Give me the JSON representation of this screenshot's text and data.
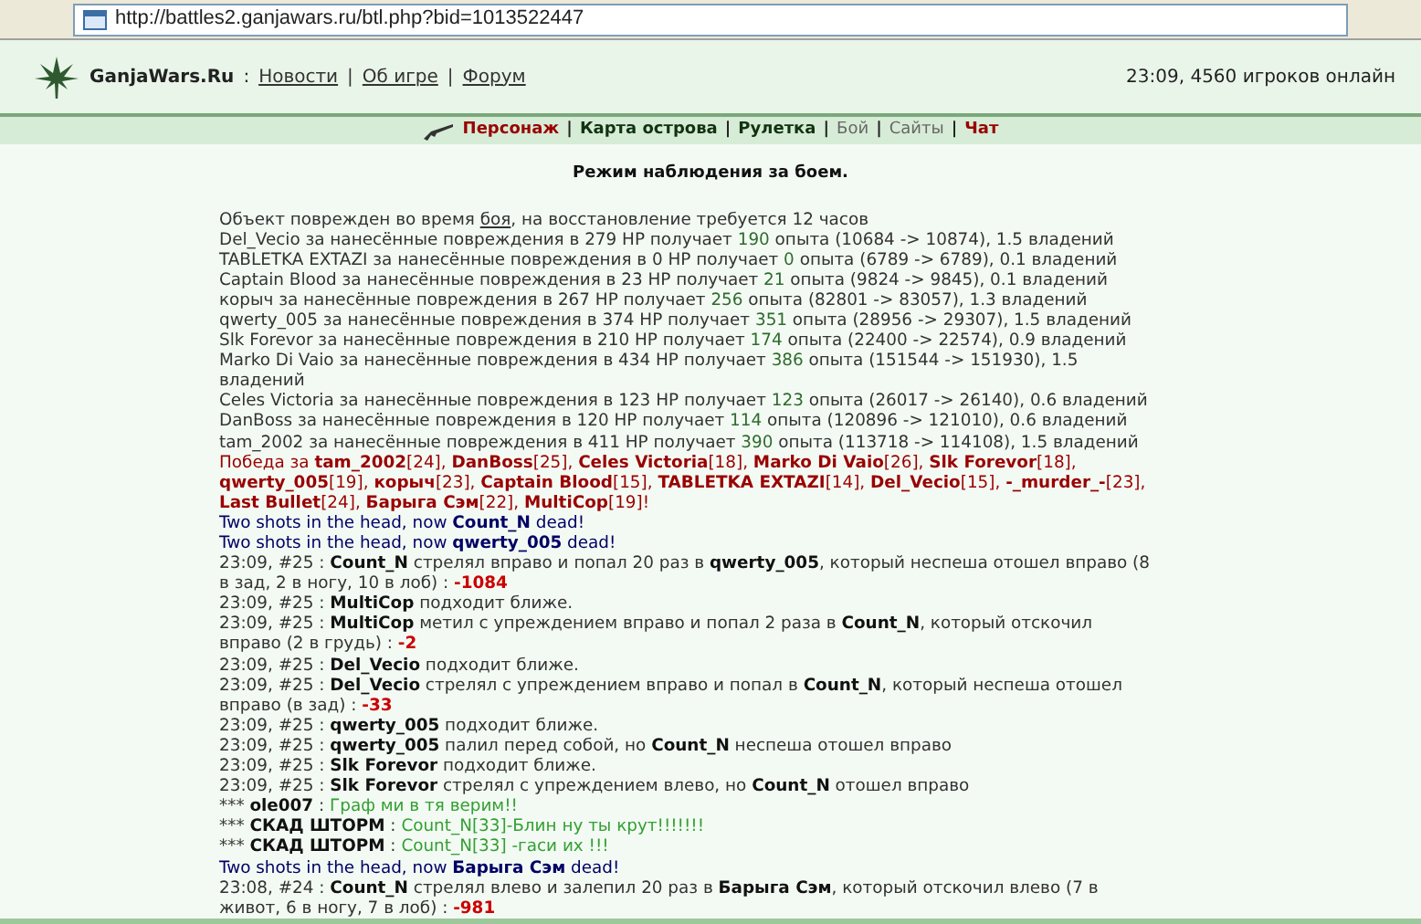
{
  "browser": {
    "address": "http://battles2.ganjawars.ru/btl.php?bid=1013522447"
  },
  "header": {
    "site": "GanjaWars.Ru",
    "colon": ":",
    "links": [
      "Новости",
      "Об игре",
      "Форум"
    ],
    "separator": "|",
    "online": "23:09, 4560 игроков онлайн"
  },
  "nav": {
    "separator": "|",
    "items": [
      {
        "label": "Персонаж",
        "kind": "accent",
        "icon": true
      },
      {
        "label": "Карта острова",
        "kind": "bold",
        "icon": false
      },
      {
        "label": "Рулетка",
        "kind": "bold",
        "icon": false
      },
      {
        "label": "Бой",
        "kind": "plain",
        "icon": false
      },
      {
        "label": "Сайты",
        "kind": "plain",
        "icon": false
      },
      {
        "label": "Чат",
        "kind": "accent",
        "icon": false
      }
    ]
  },
  "title": "Режим наблюдения за боем.",
  "log": [
    {
      "kind": "info",
      "parts": [
        {
          "kind": "t",
          "text": "Объект поврежден во время "
        },
        {
          "kind": "u",
          "text": "боя"
        },
        {
          "kind": "t",
          "text": ", на восстановление требуется 12 часов"
        }
      ]
    },
    {
      "kind": "info",
      "parts": [
        {
          "kind": "t",
          "text": "Del_Vecio за нанесённые повреждения в 279 HP получает "
        },
        {
          "kind": "x",
          "text": "190"
        },
        {
          "kind": "t",
          "text": " опыта (10684 -> 10874), 1.5 владений"
        }
      ]
    },
    {
      "kind": "info",
      "parts": [
        {
          "kind": "t",
          "text": "TABLETKA EXTAZI за нанесённые повреждения в 0 HP получает "
        },
        {
          "kind": "x",
          "text": "0"
        },
        {
          "kind": "t",
          "text": " опыта (6789 -> 6789), 0.1 владений"
        }
      ]
    },
    {
      "kind": "info",
      "parts": [
        {
          "kind": "t",
          "text": "Captain Blood за нанесённые повреждения в 23 HP получает "
        },
        {
          "kind": "x",
          "text": "21"
        },
        {
          "kind": "t",
          "text": " опыта (9824 -> 9845), 0.1 владений"
        }
      ]
    },
    {
      "kind": "info",
      "parts": [
        {
          "kind": "t",
          "text": "корыч за нанесённые повреждения в 267 HP получает "
        },
        {
          "kind": "x",
          "text": "256"
        },
        {
          "kind": "t",
          "text": " опыта (82801 -> 83057), 1.3 владений"
        }
      ]
    },
    {
      "kind": "info",
      "parts": [
        {
          "kind": "t",
          "text": "qwerty_005 за нанесённые повреждения в 374 HP получает "
        },
        {
          "kind": "x",
          "text": "351"
        },
        {
          "kind": "t",
          "text": " опыта (28956 -> 29307), 1.5 владений"
        }
      ]
    },
    {
      "kind": "info",
      "parts": [
        {
          "kind": "t",
          "text": "Slk Forevor за нанесённые повреждения в 210 HP получает "
        },
        {
          "kind": "x",
          "text": "174"
        },
        {
          "kind": "t",
          "text": " опыта (22400 -> 22574), 0.9 владений"
        }
      ]
    },
    {
      "kind": "info",
      "parts": [
        {
          "kind": "t",
          "text": "Marko Di Vaio за нанесённые повреждения в 434 HP получает "
        },
        {
          "kind": "x",
          "text": "386"
        },
        {
          "kind": "t",
          "text": " опыта (151544 -> 151930), 1.5 владений"
        }
      ]
    },
    {
      "kind": "info",
      "parts": [
        {
          "kind": "t",
          "text": "Celes Victoria за нанесённые повреждения в 123 HP получает "
        },
        {
          "kind": "x",
          "text": "123"
        },
        {
          "kind": "t",
          "text": " опыта (26017 -> 26140), 0.6 владений"
        }
      ]
    },
    {
      "kind": "info",
      "parts": [
        {
          "kind": "t",
          "text": "DanBoss за нанесённые повреждения в 120 HP получает "
        },
        {
          "kind": "x",
          "text": "114"
        },
        {
          "kind": "t",
          "text": " опыта (120896 -> 121010), 0.6 владений"
        }
      ]
    },
    {
      "kind": "info",
      "parts": [
        {
          "kind": "t",
          "text": "tam_2002 за нанесённые повреждения в 411 HP получает "
        },
        {
          "kind": "x",
          "text": "390"
        },
        {
          "kind": "t",
          "text": " опыта (113718 -> 114108), 1.5 владений"
        }
      ]
    },
    {
      "kind": "victory",
      "parts": [
        {
          "kind": "t",
          "text": "Победа за "
        },
        {
          "kind": "b",
          "text": "tam_2002"
        },
        {
          "kind": "t",
          "text": "[24], "
        },
        {
          "kind": "b",
          "text": "DanBoss"
        },
        {
          "kind": "t",
          "text": "[25], "
        },
        {
          "kind": "b",
          "text": "Celes Victoria"
        },
        {
          "kind": "t",
          "text": "[18], "
        },
        {
          "kind": "b",
          "text": "Marko Di Vaio"
        },
        {
          "kind": "t",
          "text": "[26], "
        },
        {
          "kind": "b",
          "text": "Slk Forevor"
        },
        {
          "kind": "t",
          "text": "[18], "
        },
        {
          "kind": "b",
          "text": "qwerty_005"
        },
        {
          "kind": "t",
          "text": "[19], "
        },
        {
          "kind": "b",
          "text": "корыч"
        },
        {
          "kind": "t",
          "text": "[23], "
        },
        {
          "kind": "b",
          "text": "Captain Blood"
        },
        {
          "kind": "t",
          "text": "[15], "
        },
        {
          "kind": "b",
          "text": "TABLETKA EXTAZI"
        },
        {
          "kind": "t",
          "text": "[14], "
        },
        {
          "kind": "b",
          "text": "Del_Vecio"
        },
        {
          "kind": "t",
          "text": "[15], "
        },
        {
          "kind": "b",
          "text": "-_murder_-"
        },
        {
          "kind": "t",
          "text": "[23], "
        },
        {
          "kind": "b",
          "text": "Last Bullet"
        },
        {
          "kind": "t",
          "text": "[24], "
        },
        {
          "kind": "b",
          "text": "Барыга Сэм"
        },
        {
          "kind": "t",
          "text": "[22], "
        },
        {
          "kind": "b",
          "text": "MultiCop"
        },
        {
          "kind": "t",
          "text": "[19]!"
        }
      ]
    },
    {
      "kind": "shots",
      "parts": [
        {
          "kind": "t",
          "text": "Two shots in the head, now "
        },
        {
          "kind": "b",
          "text": "Count_N"
        },
        {
          "kind": "t",
          "text": " dead!"
        }
      ]
    },
    {
      "kind": "shots",
      "parts": [
        {
          "kind": "t",
          "text": "Two shots in the head, now "
        },
        {
          "kind": "b",
          "text": "qwerty_005"
        },
        {
          "kind": "t",
          "text": " dead!"
        }
      ]
    },
    {
      "kind": "action",
      "parts": [
        {
          "kind": "t",
          "text": "23:09, #25 : "
        },
        {
          "kind": "b",
          "text": "Count_N"
        },
        {
          "kind": "t",
          "text": " стрелял вправо и попал 20 раз в "
        },
        {
          "kind": "b",
          "text": "qwerty_005"
        },
        {
          "kind": "t",
          "text": ", который неспеша отошел вправо (8 в зад, 2 в ногу, 10 в лоб) : "
        },
        {
          "kind": "d",
          "text": "-1084"
        }
      ]
    },
    {
      "kind": "action",
      "parts": [
        {
          "kind": "t",
          "text": "23:09, #25 : "
        },
        {
          "kind": "b",
          "text": "MultiCop"
        },
        {
          "kind": "t",
          "text": " подходит ближе."
        }
      ]
    },
    {
      "kind": "action",
      "parts": [
        {
          "kind": "t",
          "text": "23:09, #25 : "
        },
        {
          "kind": "b",
          "text": "MultiCop"
        },
        {
          "kind": "t",
          "text": " метил с упреждением вправо и попал 2 раза в "
        },
        {
          "kind": "b",
          "text": "Count_N"
        },
        {
          "kind": "t",
          "text": ", который отскочил вправо (2 в грудь) : "
        },
        {
          "kind": "d",
          "text": "-2"
        }
      ]
    },
    {
      "kind": "action",
      "parts": [
        {
          "kind": "t",
          "text": "23:09, #25 : "
        },
        {
          "kind": "b",
          "text": "Del_Vecio"
        },
        {
          "kind": "t",
          "text": " подходит ближе."
        }
      ]
    },
    {
      "kind": "action",
      "parts": [
        {
          "kind": "t",
          "text": "23:09, #25 : "
        },
        {
          "kind": "b",
          "text": "Del_Vecio"
        },
        {
          "kind": "t",
          "text": " стрелял с упреждением вправо и попал в "
        },
        {
          "kind": "b",
          "text": "Count_N"
        },
        {
          "kind": "t",
          "text": ", который неспеша отошел вправо (в зад) : "
        },
        {
          "kind": "d",
          "text": "-33"
        }
      ]
    },
    {
      "kind": "action",
      "parts": [
        {
          "kind": "t",
          "text": "23:09, #25 : "
        },
        {
          "kind": "b",
          "text": "qwerty_005"
        },
        {
          "kind": "t",
          "text": " подходит ближе."
        }
      ]
    },
    {
      "kind": "action",
      "parts": [
        {
          "kind": "t",
          "text": "23:09, #25 : "
        },
        {
          "kind": "b",
          "text": "qwerty_005"
        },
        {
          "kind": "t",
          "text": " палил перед собой, но "
        },
        {
          "kind": "b",
          "text": "Count_N"
        },
        {
          "kind": "t",
          "text": " неспеша отошел вправо"
        }
      ]
    },
    {
      "kind": "action",
      "parts": [
        {
          "kind": "t",
          "text": "23:09, #25 : "
        },
        {
          "kind": "b",
          "text": "Slk Forevor"
        },
        {
          "kind": "t",
          "text": " подходит ближе."
        }
      ]
    },
    {
      "kind": "action",
      "parts": [
        {
          "kind": "t",
          "text": "23:09, #25 : "
        },
        {
          "kind": "b",
          "text": "Slk Forevor"
        },
        {
          "kind": "t",
          "text": " стрелял с упреждением влево, но "
        },
        {
          "kind": "b",
          "text": "Count_N"
        },
        {
          "kind": "t",
          "text": " отошел вправо"
        }
      ]
    },
    {
      "kind": "chat",
      "parts": [
        {
          "kind": "t",
          "text": "*** "
        },
        {
          "kind": "b",
          "text": "ole007"
        },
        {
          "kind": "t",
          "text": " : "
        },
        {
          "kind": "g",
          "text": "Граф ми в тя верим!!"
        }
      ]
    },
    {
      "kind": "chat",
      "parts": [
        {
          "kind": "t",
          "text": "*** "
        },
        {
          "kind": "b",
          "text": "СКАД ШТОРМ"
        },
        {
          "kind": "t",
          "text": " : "
        },
        {
          "kind": "g",
          "text": "Count_N[33]-Блин ну ты крут!!!!!!!"
        }
      ]
    },
    {
      "kind": "chat",
      "parts": [
        {
          "kind": "t",
          "text": "*** "
        },
        {
          "kind": "b",
          "text": "СКАД ШТОРМ"
        },
        {
          "kind": "t",
          "text": " : "
        },
        {
          "kind": "g",
          "text": "Count_N[33] -гаси их !!!"
        }
      ]
    },
    {
      "kind": "shots",
      "parts": [
        {
          "kind": "t",
          "text": "Two shots in the head, now "
        },
        {
          "kind": "b",
          "text": "Барыга Сэм"
        },
        {
          "kind": "t",
          "text": " dead!"
        }
      ]
    },
    {
      "kind": "action",
      "parts": [
        {
          "kind": "t",
          "text": "23:08, #24 : "
        },
        {
          "kind": "b",
          "text": "Count_N"
        },
        {
          "kind": "t",
          "text": " стрелял влево и залепил 20 раз в "
        },
        {
          "kind": "b",
          "text": "Барыга Сэм"
        },
        {
          "kind": "t",
          "text": ", который отскочил влево (7 в живот, 6 в ногу, 7 в лоб) : "
        },
        {
          "kind": "d",
          "text": "-981"
        }
      ]
    }
  ]
}
